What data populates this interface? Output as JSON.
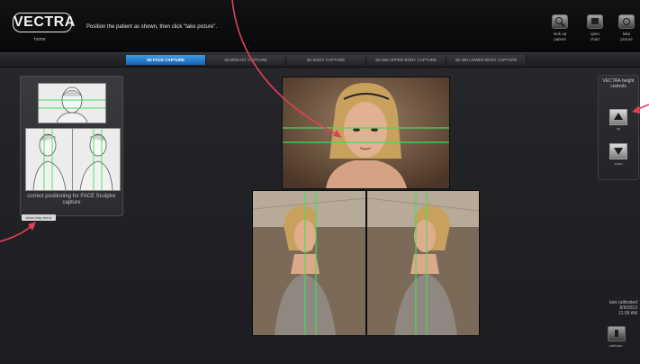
{
  "header": {
    "logo": "VECTRA",
    "home_link": "home",
    "instruction": "Position the patient as shown, then click \"take picture\".",
    "buttons": [
      {
        "label": "look up\npatient",
        "icon": "search-icon"
      },
      {
        "label": "open\nchart",
        "icon": "chart-icon"
      },
      {
        "label": "take\npicture",
        "icon": "camera-icon"
      }
    ]
  },
  "tabs": [
    {
      "label": "3D FACE CAPTURE",
      "active": true
    },
    {
      "label": "3D BREAST CAPTURE",
      "active": false
    },
    {
      "label": "3D BODY CAPTURE",
      "active": false
    },
    {
      "label": "3D 360 UPPER BODY CAPTURE",
      "active": false
    },
    {
      "label": "3D 360 LOWER BODY CAPTURE",
      "active": false
    }
  ],
  "guide": {
    "caption": "correct positioning for FACE Sculptor capture",
    "helptext_button": "show help text ▸"
  },
  "height_controls": {
    "title": "VECTRA height controls",
    "up_label": "up",
    "down_label": "down"
  },
  "calibration": {
    "text": "last calibrated\n8/9/2013\n11:09 AM",
    "button_label": "calibrate"
  },
  "colors": {
    "accent": "#2a82d4",
    "guide_line": "#3fe05a",
    "pointer": "#e0405a"
  }
}
